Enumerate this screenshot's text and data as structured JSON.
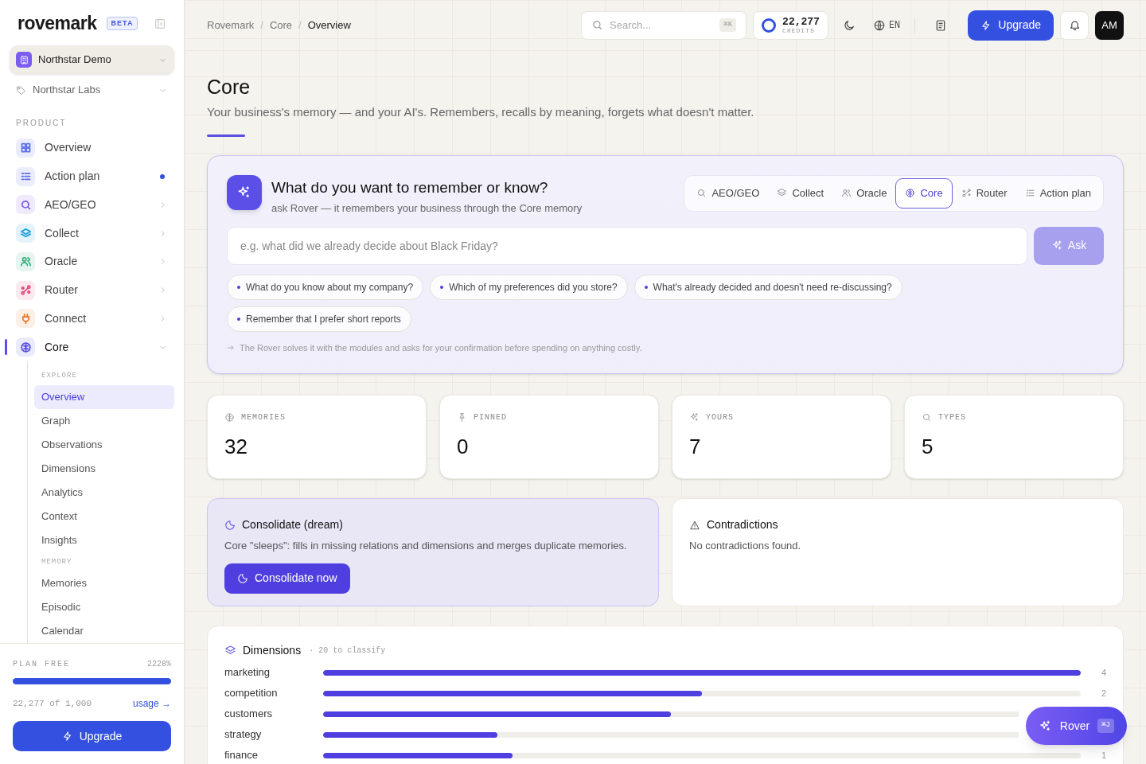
{
  "brand": {
    "name": "rovemark",
    "badge": "BETA"
  },
  "workspace": {
    "name": "Northstar Demo",
    "org": "Northstar Labs"
  },
  "nav_section": "PRODUCT",
  "nav": [
    {
      "label": "Overview",
      "color": "#5b6ee8",
      "kind": "link",
      "selected": false,
      "has_update": false
    },
    {
      "label": "Action plan",
      "color": "#5b6ee8",
      "kind": "link",
      "selected": false,
      "has_update": true
    },
    {
      "label": "AEO/GEO",
      "color": "#7c5ce8",
      "kind": "group",
      "selected": false,
      "expanded": false
    },
    {
      "label": "Collect",
      "color": "#1fa0d8",
      "kind": "group",
      "selected": false,
      "expanded": false
    },
    {
      "label": "Oracle",
      "color": "#2fb07a",
      "kind": "group",
      "selected": false,
      "expanded": false
    },
    {
      "label": "Router",
      "color": "#e0467a",
      "kind": "group",
      "selected": false,
      "expanded": false
    },
    {
      "label": "Connect",
      "color": "#e8782a",
      "kind": "group",
      "selected": false,
      "expanded": false
    },
    {
      "label": "Core",
      "color": "#5b4fe0",
      "kind": "group",
      "selected": true,
      "expanded": true
    }
  ],
  "subnav": [
    {
      "heading": "EXPLORE",
      "items": [
        {
          "label": "Overview",
          "selected": true
        },
        {
          "label": "Graph",
          "selected": false
        },
        {
          "label": "Observations",
          "selected": false
        },
        {
          "label": "Dimensions",
          "selected": false
        },
        {
          "label": "Analytics",
          "selected": false
        },
        {
          "label": "Context",
          "selected": false
        },
        {
          "label": "Insights",
          "selected": false
        }
      ]
    },
    {
      "heading": "MEMORY",
      "items": [
        {
          "label": "Memories",
          "selected": false
        },
        {
          "label": "Episodic",
          "selected": false
        },
        {
          "label": "Calendar",
          "selected": false
        }
      ]
    }
  ],
  "plan": {
    "label": "PLAN FREE",
    "percent": "2228%",
    "level": 1,
    "usage": "22,277 of 1,000",
    "link": "usage →",
    "button": "Upgrade"
  },
  "breadcrumbs": [
    "Rovemark",
    "Core",
    "Overview"
  ],
  "breadcrumb_separator": "/",
  "header": {
    "search_placeholder": "Search...",
    "shortcut": "⌘K",
    "credits": "22,277",
    "credits_label": "CREDITS",
    "language": "EN",
    "upgrade": "Upgrade",
    "avatar": "AM"
  },
  "page": {
    "title": "Core",
    "subtitle": "Your business's memory — and your AI's. Remembers, recalls by meaning, forgets what doesn't matter."
  },
  "ask": {
    "title": "What do you want to remember or know?",
    "subtitle": "ask Rover — it remembers your business through the Core memory",
    "modules": [
      {
        "label": "AEO/GEO",
        "selected": false
      },
      {
        "label": "Collect",
        "selected": false
      },
      {
        "label": "Oracle",
        "selected": false
      },
      {
        "label": "Core",
        "selected": true
      },
      {
        "label": "Router",
        "selected": false
      },
      {
        "label": "Action plan",
        "selected": false
      }
    ],
    "placeholder": "e.g. what did we already decide about Black Friday?",
    "button": "Ask",
    "disabled": true,
    "suggestions": [
      "What do you know about my company?",
      "Which of my preferences did you store?",
      "What's already decided and doesn't need re-discussing?",
      "Remember that I prefer short reports"
    ],
    "note": "The Rover solves it with the modules and asks for your confirmation before spending on anything costly."
  },
  "stats": [
    {
      "label": "MEMORIES",
      "value": "32"
    },
    {
      "label": "PINNED",
      "value": "0"
    },
    {
      "label": "YOURS",
      "value": "7"
    },
    {
      "label": "TYPES",
      "value": "5"
    }
  ],
  "consolidate": {
    "title": "Consolidate (dream)",
    "text": "Core \"sleeps\": fills in missing relations and dimensions and merges duplicate memories.",
    "button": "Consolidate now"
  },
  "contradictions": {
    "title": "Contradictions",
    "text": "No contradictions found."
  },
  "dimensions": {
    "title": "Dimensions",
    "note": "· 20 to classify",
    "rows": [
      {
        "name": "marketing",
        "level": 1,
        "count": "4"
      },
      {
        "name": "competition",
        "level": 0.5,
        "count": "2"
      },
      {
        "name": "customers",
        "level": 0.5
      },
      {
        "name": "strategy",
        "level": 0.25
      },
      {
        "name": "finance",
        "level": 0.25,
        "count": "1"
      }
    ]
  },
  "rover": {
    "label": "Rover",
    "shortcut": "⌘J"
  }
}
